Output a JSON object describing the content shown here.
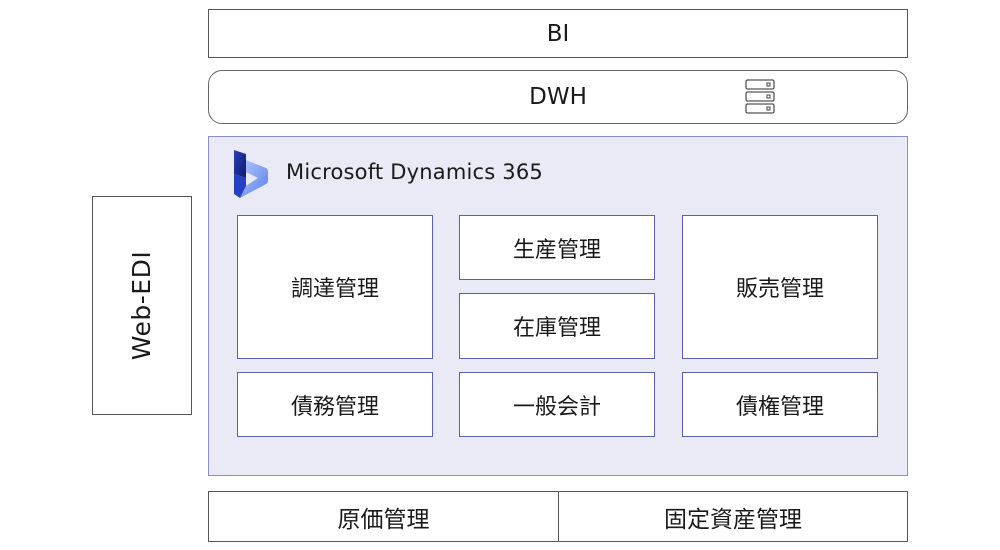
{
  "bi": {
    "label": "BI"
  },
  "dwh": {
    "label": "DWH",
    "icon": "server-icon"
  },
  "dynamics": {
    "title": "Microsoft Dynamics 365",
    "logo": "dynamics-365-logo-icon",
    "modules": {
      "procurement": "調達管理",
      "production": "生産管理",
      "inventory": "在庫管理",
      "sales": "販売管理",
      "payable": "債務管理",
      "general_ledger": "一般会計",
      "receivable": "債権管理"
    },
    "colors": {
      "panel_bg": "#e9eaf6",
      "panel_border": "#8a8fc9",
      "logo_dark": "#1f2d8f",
      "logo_light": "#8fb3f5"
    }
  },
  "webedi": {
    "label": "Web-EDI"
  },
  "bottom": {
    "cost": "原価管理",
    "fixed_assets": "固定資産管理"
  }
}
